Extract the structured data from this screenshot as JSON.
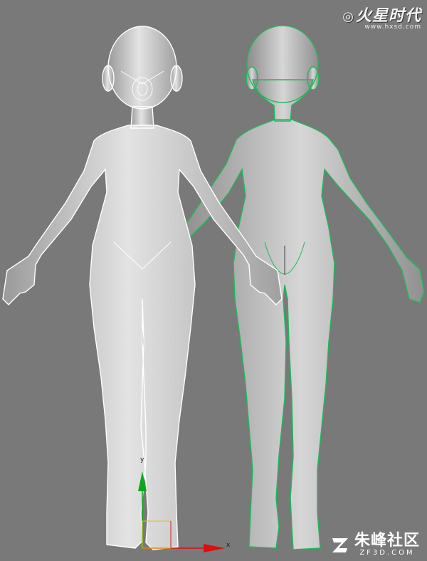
{
  "viewport": {
    "background": "#797979",
    "wire_white": "#ffffff",
    "wire_green": "#1fb85a"
  },
  "gizmo": {
    "y_label": "y",
    "x_label": "x",
    "y_color": "#0aa81e",
    "x_color": "#d81010"
  },
  "watermark_top": {
    "brand": "火星时代",
    "url": "www.hxsd.com"
  },
  "watermark_bottom": {
    "brand": "朱峰社区",
    "url": "ZF3D.COM"
  }
}
